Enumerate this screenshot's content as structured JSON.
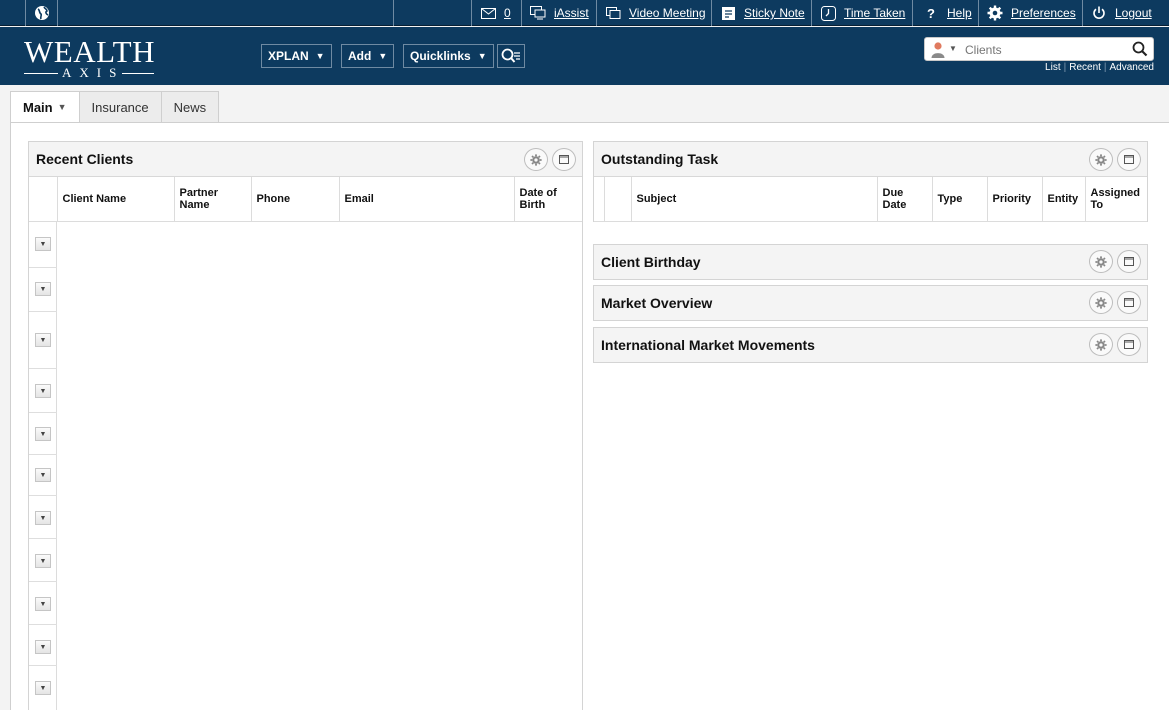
{
  "topbar": {
    "items": [
      {
        "icon": "mail-icon",
        "label": "0"
      },
      {
        "icon": "iassist-icon",
        "label": "iAssist"
      },
      {
        "icon": "video-icon",
        "label": "Video Meeting"
      },
      {
        "icon": "sticky-note-icon",
        "label": "Sticky Note"
      },
      {
        "icon": "clock-icon",
        "label": "Time Taken"
      },
      {
        "icon": "help-icon",
        "label": "Help"
      },
      {
        "icon": "gear-icon",
        "label": "Preferences"
      },
      {
        "icon": "power-icon",
        "label": "Logout"
      }
    ]
  },
  "header": {
    "logo_text": "WEALTH",
    "logo_sub": "AXIS",
    "nav": [
      {
        "label": "XPLAN"
      },
      {
        "label": "Add"
      },
      {
        "label": "Quicklinks"
      }
    ],
    "search": {
      "placeholder": "Clients",
      "links": [
        "List",
        "Recent",
        "Advanced"
      ]
    }
  },
  "tabs": [
    {
      "label": "Main",
      "active": true
    },
    {
      "label": "Insurance",
      "active": false
    },
    {
      "label": "News",
      "active": false
    }
  ],
  "recent_clients": {
    "title": "Recent Clients",
    "columns": [
      "Client Name",
      "Partner Name",
      "Phone",
      "Email",
      "Date of Birth"
    ],
    "rows": 11
  },
  "outstanding_task": {
    "title": "Outstanding Task",
    "columns": [
      "Subject",
      "Due Date",
      "Type",
      "Priority",
      "Entity",
      "Assigned To"
    ]
  },
  "widgets": [
    {
      "title": "Client Birthday"
    },
    {
      "title": "Market Overview"
    },
    {
      "title": "International Market Movements"
    }
  ],
  "colors": {
    "brand_navy": "#0d3a5f",
    "panel_header": "#f4f4f4"
  }
}
